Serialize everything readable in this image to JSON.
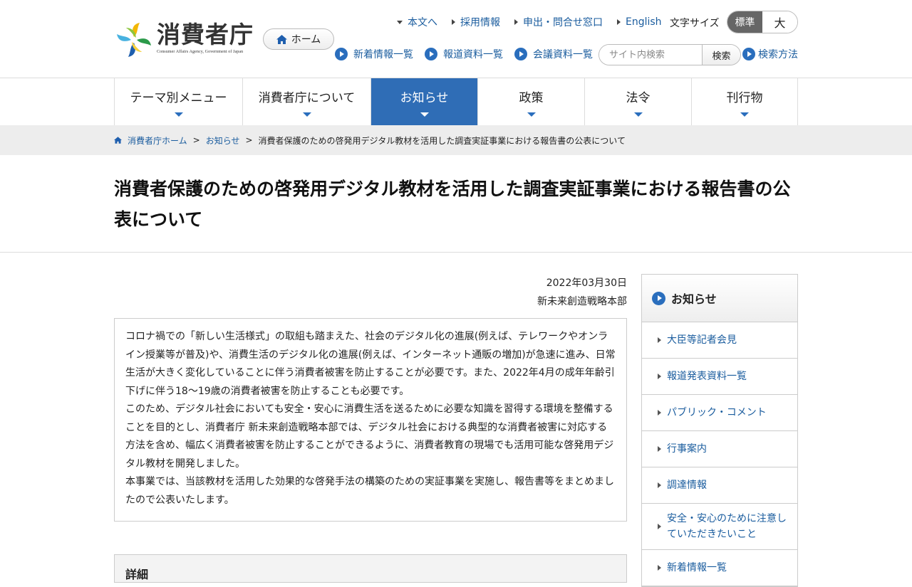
{
  "logo": {
    "name": "消費者庁",
    "sub": "Consumer Affairs Agency, Government of Japan"
  },
  "header": {
    "home_label": "ホーム",
    "top_links": [
      "本文へ",
      "採用情報",
      "申出・問合せ窓口",
      "English"
    ],
    "font_size_label": "文字サイズ",
    "font_size_std": "標準",
    "font_size_big": "大",
    "sub_links": [
      "新着情報一覧",
      "報道資料一覧",
      "会議資料一覧"
    ],
    "search_placeholder": "サイト内検索",
    "search_button": "検索",
    "search_method": "検索方法"
  },
  "gnav": [
    "テーマ別メニュー",
    "消費者庁について",
    "お知らせ",
    "政策",
    "法令",
    "刊行物"
  ],
  "breadcrumb": {
    "home": "消費者庁ホーム",
    "parent": "お知らせ",
    "current": "消費者保護のための啓発用デジタル教材を活用した調査実証事業における報告書の公表について"
  },
  "page": {
    "title": "消費者保護のための啓発用デジタル教材を活用した調査実証事業における報告書の公表について",
    "date": "2022年03月30日",
    "dept": "新未来創造戦略本部",
    "paragraphs": [
      "コロナ禍での「新しい生活様式」の取組も踏まえた、社会のデジタル化の進展(例えば、テレワークやオンライン授業等が普及)や、消費生活のデジタル化の進展(例えば、インターネット通販の増加)が急速に進み、日常生活が大きく変化していることに伴う消費者被害を防止することが必要です。また、2022年4月の成年年齢引下げに伴う18～19歳の消費者被害を防止することも必要です。",
      "このため、デジタル社会においても安全・安心に消費生活を送るために必要な知識を習得する環境を整備することを目的とし、消費者庁 新未来創造戦略本部では、デジタル社会における典型的な消費者被害に対応する方法を含め、幅広く消費者被害を防止することができるように、消費者教育の現場でも活用可能な啓発用デジタル教材を開発しました。",
      "本事業では、当該教材を活用した効果的な啓発手法の構築のための実証事業を実施し、報告書等をまとめましたので公表いたします。"
    ],
    "detail_heading": "詳細"
  },
  "side": {
    "heading": "お知らせ",
    "items": [
      "大臣等記者会見",
      "報道発表資料一覧",
      "パブリック・コメント",
      "行事案内",
      "調達情報",
      "安全・安心のために注意していただきたいこと",
      "新着情報一覧"
    ]
  },
  "colors": {
    "accent": "#2f6db6",
    "link": "#1a5c9e",
    "breadcrumb_bg": "#ededed"
  }
}
